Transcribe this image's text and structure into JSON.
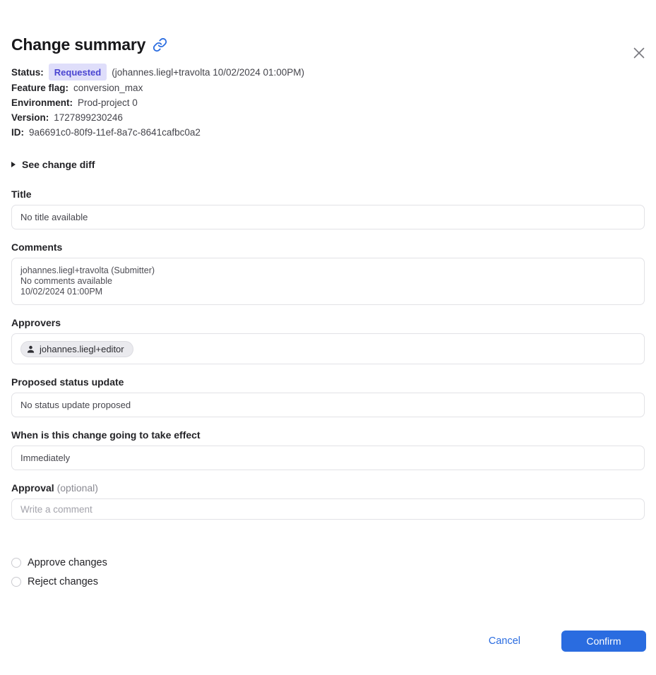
{
  "modal": {
    "title": "Change summary"
  },
  "meta": {
    "status_label": "Status:",
    "status_badge": "Requested",
    "status_detail": "(johannes.liegl+travolta 10/02/2024 01:00PM)",
    "rows": [
      {
        "label": "Feature flag:",
        "value": "conversion_max"
      },
      {
        "label": "Environment:",
        "value": "Prod-project 0"
      },
      {
        "label": "Version:",
        "value": "1727899230246"
      },
      {
        "label": "ID:",
        "value": "9a6691c0-80f9-11ef-8a7c-8641cafbc0a2"
      }
    ]
  },
  "disclosure": {
    "label": "See change diff"
  },
  "sections": {
    "title": {
      "label": "Title",
      "value": "No title available"
    },
    "comments": {
      "label": "Comments",
      "lines": [
        "johannes.liegl+travolta (Submitter)",
        "No comments available",
        "10/02/2024 01:00PM"
      ]
    },
    "approvers": {
      "label": "Approvers",
      "chip": "johannes.liegl+editor"
    },
    "proposed_status": {
      "label": "Proposed status update",
      "value": "No status update proposed"
    },
    "effect": {
      "label": "When is this change going to take effect",
      "value": "Immediately"
    },
    "approval": {
      "label": "Approval",
      "optional": "(optional)",
      "placeholder": "Write a comment"
    }
  },
  "radios": [
    {
      "label": "Approve changes"
    },
    {
      "label": "Reject changes"
    }
  ],
  "footer": {
    "cancel": "Cancel",
    "confirm": "Confirm"
  },
  "colors": {
    "accent_blue": "#2a6ce0",
    "badge_bg": "#dfdefa",
    "badge_text": "#4a45d1"
  }
}
